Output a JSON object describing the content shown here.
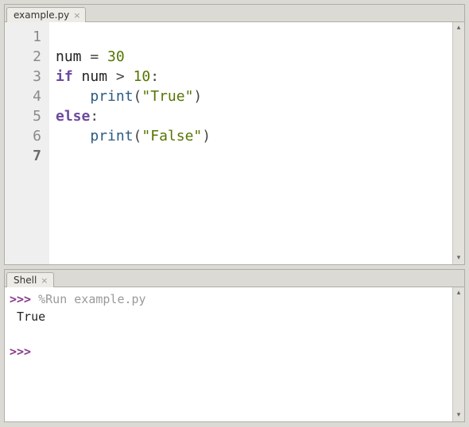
{
  "editor": {
    "tab_label": "example.py",
    "line_numbers": [
      "1",
      "2",
      "3",
      "4",
      "5",
      "6",
      "7"
    ],
    "current_line_index": 6,
    "code_lines": [
      {
        "tokens": [
          {
            "t": " ",
            "c": ""
          }
        ]
      },
      {
        "tokens": [
          {
            "t": "num ",
            "c": ""
          },
          {
            "t": "=",
            "c": "op"
          },
          {
            "t": " ",
            "c": ""
          },
          {
            "t": "30",
            "c": "num"
          }
        ]
      },
      {
        "tokens": [
          {
            "t": "if",
            "c": "kw"
          },
          {
            "t": " num ",
            "c": ""
          },
          {
            "t": ">",
            "c": "op"
          },
          {
            "t": " ",
            "c": ""
          },
          {
            "t": "10",
            "c": "num"
          },
          {
            "t": ":",
            "c": "op"
          }
        ]
      },
      {
        "tokens": [
          {
            "t": "    ",
            "c": ""
          },
          {
            "t": "print",
            "c": "fn"
          },
          {
            "t": "(",
            "c": "op"
          },
          {
            "t": "\"True\"",
            "c": "str"
          },
          {
            "t": ")",
            "c": "op"
          }
        ]
      },
      {
        "tokens": [
          {
            "t": "else",
            "c": "kw"
          },
          {
            "t": ":",
            "c": "op"
          }
        ]
      },
      {
        "tokens": [
          {
            "t": "    ",
            "c": ""
          },
          {
            "t": "print",
            "c": "fn"
          },
          {
            "t": "(",
            "c": "op"
          },
          {
            "t": "\"False\"",
            "c": "str"
          },
          {
            "t": ")",
            "c": "op"
          }
        ]
      },
      {
        "tokens": [
          {
            "t": " ",
            "c": ""
          }
        ]
      }
    ]
  },
  "shell": {
    "tab_label": "Shell",
    "prompt": ">>>",
    "run_command": "%Run example.py",
    "output": " True"
  },
  "icons": {
    "up": "▴",
    "down": "▾"
  }
}
